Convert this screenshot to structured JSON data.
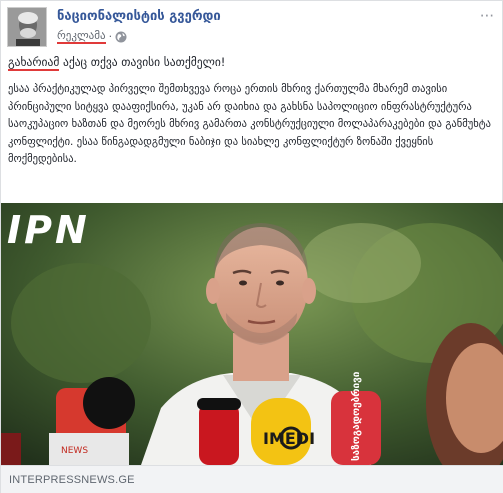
{
  "page": {
    "name": "ნაციონალისტის გვერდი",
    "sponsored_label": "რეკლამა",
    "separator": "·",
    "more_options": "···"
  },
  "post": {
    "headline_marked": "გახარიამ",
    "headline_rest": " აქაც თქვა თავისი სათქმელი!",
    "body": "ესაა პრაქტიკულად პირველი შემთხვევა როცა ერთის მხრივ ქართულმა მხარემ თავისი პრინციპული სიტყვა დააფიქსირა, უკან არ დაიხია და გახსნა საპოლიციო ინფრასტრუქტურა საოკუპაციო ხაზთან და მეორეს მხრივ გამართა კონსტრუქციული მოლაპარაკებები და განმუხტა კონფლიქტი. ესაა წინგადადგმული ნაბიჯი და სიახლე კონფლიქტურ ზონაში ქვეყნის მოქმედებისა."
  },
  "photo": {
    "watermark": "IPN",
    "mic_label_1": "საზოგადოებრივი",
    "mic_label_2": "IMEDI",
    "mic_label_3": "NEWS"
  },
  "link": {
    "domain": "INTERPRESSNEWS.GE"
  },
  "colors": {
    "page_name": "#365899",
    "highlight_underline": "#e03a3a",
    "link_bar": "#f2f3f5"
  }
}
